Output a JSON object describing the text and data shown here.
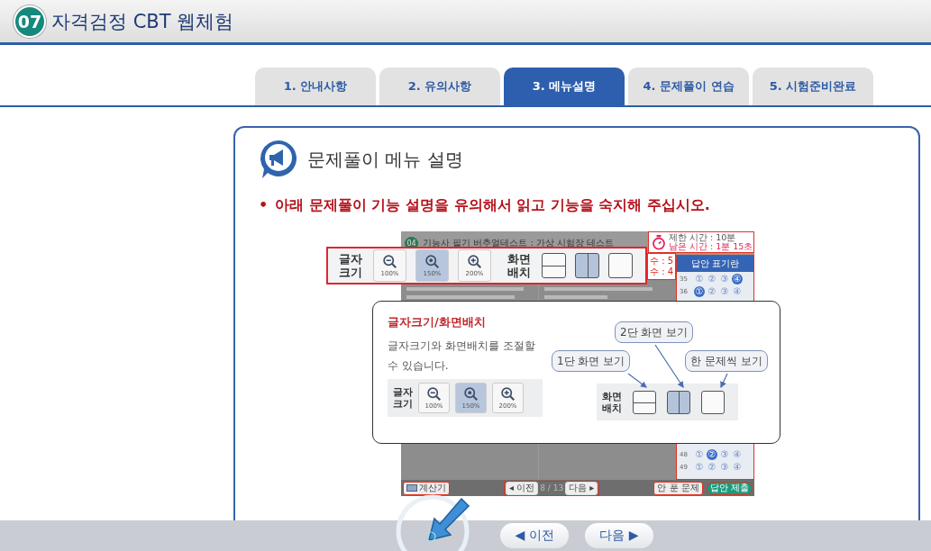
{
  "header": {
    "badge": "07",
    "title": "자격검정 CBT 웹체험"
  },
  "tabs": [
    {
      "label": "1. 안내사항",
      "selected": false
    },
    {
      "label": "2. 유의사항",
      "selected": false
    },
    {
      "label": "3. 메뉴설명",
      "selected": true
    },
    {
      "label": "4. 문제풀이 연습",
      "selected": false
    },
    {
      "label": "5. 시험준비완료",
      "selected": false
    }
  ],
  "section": {
    "title": "문제풀이 메뉴 설명",
    "bullet": "•",
    "notice": "아래 문제풀이 기능 설명을 유의해서 읽고 기능을 숙지해 주십시오."
  },
  "exam_screen": {
    "badge": "04",
    "title": "기능사 필기 버추얼테스트 : 가상 시험장 테스트",
    "time_limit": "제한 시간 : 10분",
    "time_left": "남은 시간 : 1분 15초",
    "counts": [
      "수 : 5",
      "수 : 4"
    ],
    "answer_sheet": {
      "title": "답안 표기란",
      "rows": [
        {
          "number": "35",
          "choices": [
            {
              "label": "①",
              "selected": false
            },
            {
              "label": "②",
              "selected": false
            },
            {
              "label": "③",
              "selected": false
            },
            {
              "label": "④",
              "selected": true
            }
          ]
        },
        {
          "number": "36",
          "choices": [
            {
              "label": "①",
              "selected": true
            },
            {
              "label": "②",
              "selected": false
            },
            {
              "label": "③",
              "selected": false
            },
            {
              "label": "④",
              "selected": false
            }
          ]
        },
        {
          "number": "48",
          "choices": [
            {
              "label": "①",
              "selected": false
            },
            {
              "label": "②",
              "selected": true
            },
            {
              "label": "③",
              "selected": false
            },
            {
              "label": "④",
              "selected": false
            }
          ]
        },
        {
          "number": "49",
          "choices": [
            {
              "label": "①",
              "selected": false
            },
            {
              "label": "②",
              "selected": false
            },
            {
              "label": "③",
              "selected": false
            },
            {
              "label": "④",
              "selected": false
            }
          ]
        }
      ]
    },
    "calculator": "계산기",
    "prev": "◂ 이전",
    "page": "8 / 13",
    "next": "다음 ▸",
    "unsolved": "안 푼 문제",
    "submit": "답안 제출"
  },
  "toolbar": {
    "font_label": "글자\n크기",
    "layout_label": "화면\n배치",
    "zoom": [
      {
        "kind": "zoom-out",
        "label": "100%",
        "selected": false
      },
      {
        "kind": "zoom-mid",
        "label": "150%",
        "selected": true
      },
      {
        "kind": "zoom-in",
        "label": "200%",
        "selected": false
      }
    ],
    "layouts": [
      {
        "kind": "rows",
        "selected": false
      },
      {
        "kind": "columns",
        "selected": true
      },
      {
        "kind": "single",
        "selected": false
      }
    ]
  },
  "popup": {
    "title": "글자크기/화면배치",
    "description": "글자크기와 화면배치를 조절할 수 있습니다.",
    "font_label": "글자\n크기",
    "layout_label": "화면\n배치",
    "zoom": [
      {
        "kind": "zoom-out",
        "label": "100%",
        "selected": false
      },
      {
        "kind": "zoom-mid",
        "label": "150%",
        "selected": true
      },
      {
        "kind": "zoom-in",
        "label": "200%",
        "selected": false
      }
    ],
    "layouts": [
      {
        "kind": "rows",
        "selected": false
      },
      {
        "kind": "columns",
        "selected": true
      },
      {
        "kind": "single",
        "selected": false
      }
    ],
    "callouts": [
      "1단 화면 보기",
      "2단 화면 보기",
      "한 문제씩 보기"
    ]
  },
  "nav": {
    "prev": "◀ 이전",
    "next": "다음 ▶"
  }
}
